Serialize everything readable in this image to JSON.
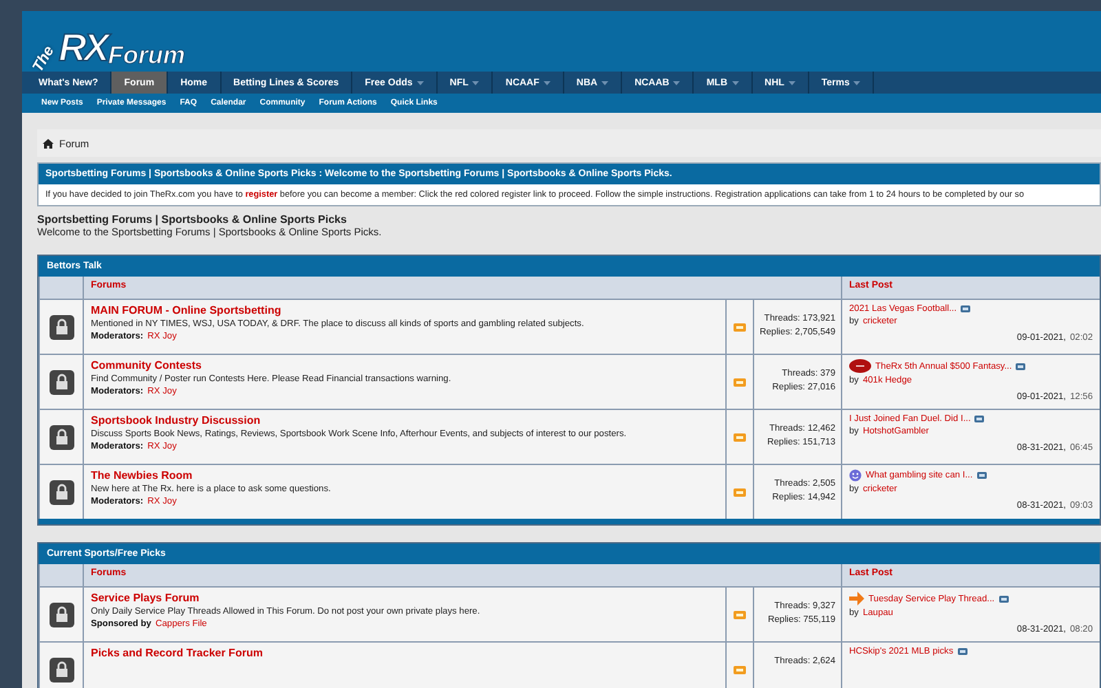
{
  "logo": {
    "prefix": "The",
    "mark": "RX",
    "name": "Forum"
  },
  "nav": [
    {
      "label": "What's New?",
      "selected": false,
      "has_menu": false
    },
    {
      "label": "Forum",
      "selected": true,
      "has_menu": false
    },
    {
      "label": "Home",
      "selected": false,
      "has_menu": false
    },
    {
      "label": "Betting Lines & Scores",
      "selected": false,
      "has_menu": false
    },
    {
      "label": "Free Odds",
      "selected": false,
      "has_menu": true
    },
    {
      "label": "NFL",
      "selected": false,
      "has_menu": true
    },
    {
      "label": "NCAAF",
      "selected": false,
      "has_menu": true
    },
    {
      "label": "NBA",
      "selected": false,
      "has_menu": true
    },
    {
      "label": "NCAAB",
      "selected": false,
      "has_menu": true
    },
    {
      "label": "MLB",
      "selected": false,
      "has_menu": true
    },
    {
      "label": "NHL",
      "selected": false,
      "has_menu": true
    },
    {
      "label": "Terms",
      "selected": false,
      "has_menu": true
    }
  ],
  "subnav": [
    "New Posts",
    "Private Messages",
    "FAQ",
    "Calendar",
    "Community",
    "Forum Actions",
    "Quick Links"
  ],
  "breadcrumb": "Forum",
  "notice": {
    "title": "Sportsbetting Forums | Sportsbooks & Online Sports Picks : Welcome to the Sportsbetting Forums | Sportsbooks & Online Sports Picks.",
    "before": "If you have decided to join TheRx.com you have to",
    "link": "register",
    "after": "before you can become a member: Click the red colored register link to proceed. Follow the simple instructions. Registration applications can take from 1 to 24 hours to be completed by our so"
  },
  "intro": {
    "title": "Sportsbetting Forums | Sportsbooks & Online Sports Picks",
    "text": "Welcome to the Sportsbetting Forums | Sportsbooks & Online Sports Picks."
  },
  "sections": [
    {
      "title": "Bettors Talk",
      "col_forums": "Forums",
      "col_last": "Last Post",
      "forums": [
        {
          "title": "MAIN FORUM - Online Sportsbetting",
          "description": "Mentioned in NY TIMES, WSJ, USA TODAY, & DRF. The place to discuss all kinds of sports and gambling related subjects.",
          "staff_label": "Moderators:",
          "staff": "RX Joy",
          "kind": "plain",
          "threads": "Threads: 173,921",
          "replies": "Replies: 2,705,549",
          "last_title": "2021 Las Vegas Football...",
          "by": "by",
          "last_user": "cricketer",
          "date": "09-01-2021,",
          "time": "02:02"
        },
        {
          "title": "Community Contests",
          "description": "Find Community / Poster run Contests Here. Please Read Financial transactions warning.",
          "staff_label": "Moderators:",
          "staff": "RX Joy",
          "threads": "Threads: 379",
          "replies": "Replies: 27,016",
          "kind": "football",
          "last_title": "TheRx 5th Annual $500 Fantasy...",
          "by": "by",
          "last_user": "401k Hedge",
          "date": "09-01-2021,",
          "time": "12:56"
        },
        {
          "title": "Sportsbook Industry Discussion",
          "description": "Discuss Sports Book News, Ratings, Reviews, Sportsbook Work Scene Info, Afterhour Events, and subjects of interest to our posters.",
          "staff_label": "Moderators:",
          "staff": "RX Joy",
          "kind": "plain",
          "threads": "Threads: 12,462",
          "replies": "Replies: 151,713",
          "last_title": "I Just Joined Fan Duel. Did I...",
          "by": "by",
          "last_user": "HotshotGambler",
          "date": "08-31-2021,",
          "time": "06:45"
        },
        {
          "title": "The Newbies Room",
          "description": "New here at The Rx. here is a place to ask some questions.",
          "staff_label": "Moderators:",
          "staff": "RX Joy",
          "threads": "Threads: 2,505",
          "replies": "Replies: 14,942",
          "kind": "smiley",
          "last_title": "What gambling site can I...",
          "by": "by",
          "last_user": "cricketer",
          "date": "08-31-2021,",
          "time": "09:03"
        }
      ]
    },
    {
      "title": "Current Sports/Free Picks",
      "col_forums": "Forums",
      "col_last": "Last Post",
      "forums": [
        {
          "title": "Service Plays Forum",
          "description": "Only Daily Service Play Threads Allowed in This Forum. Do not post your own private plays here.",
          "staff_label": "Sponsored by",
          "staff": "Cappers File",
          "threads": "Threads: 9,327",
          "replies": "Replies: 755,119",
          "kind": "arrow",
          "last_title": "Tuesday Service Play Thread...",
          "by": "by",
          "last_user": "Laupau",
          "date": "08-31-2021,",
          "time": "08:20"
        },
        {
          "title": "Picks and Record Tracker Forum",
          "kind": "plain",
          "threads": "Threads: 2,624",
          "last_title": "HCSkip's 2021 MLB picks"
        }
      ]
    }
  ]
}
